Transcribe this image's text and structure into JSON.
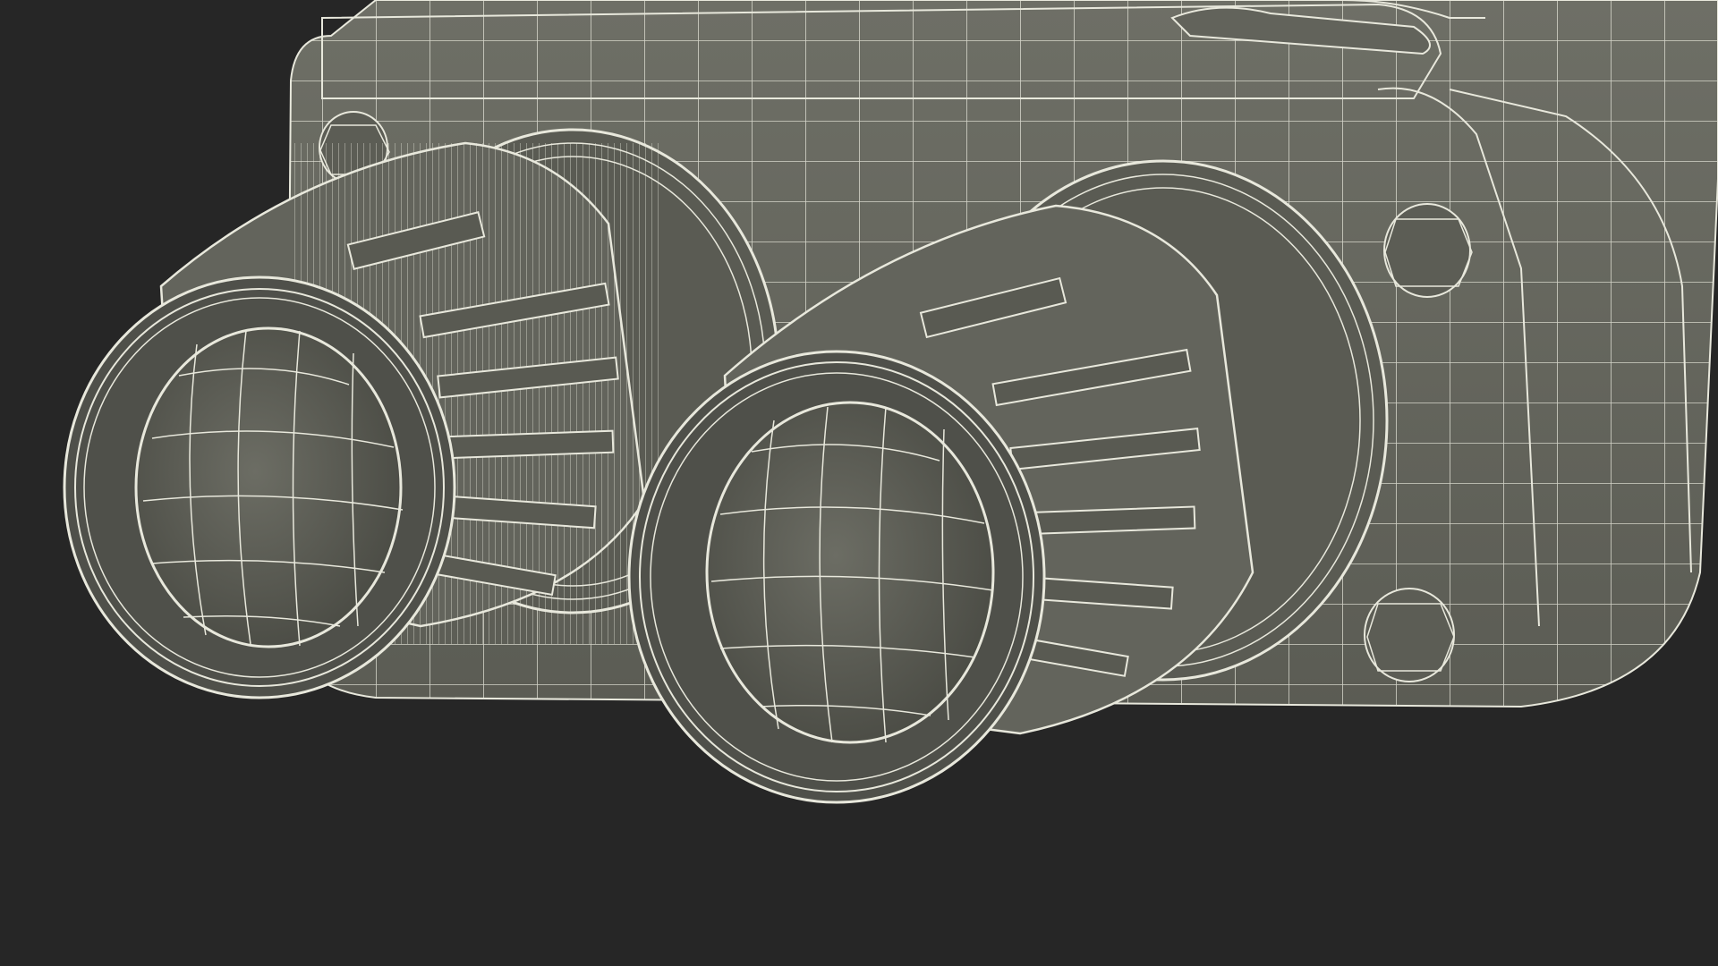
{
  "scene": {
    "subject": "binocular-wireframe-model",
    "colors": {
      "background": "#262626",
      "surface": "#6a6b62",
      "surface_dark": "#55564e",
      "surface_shadow": "#3f403a",
      "wire": "#e8e8dc"
    }
  }
}
